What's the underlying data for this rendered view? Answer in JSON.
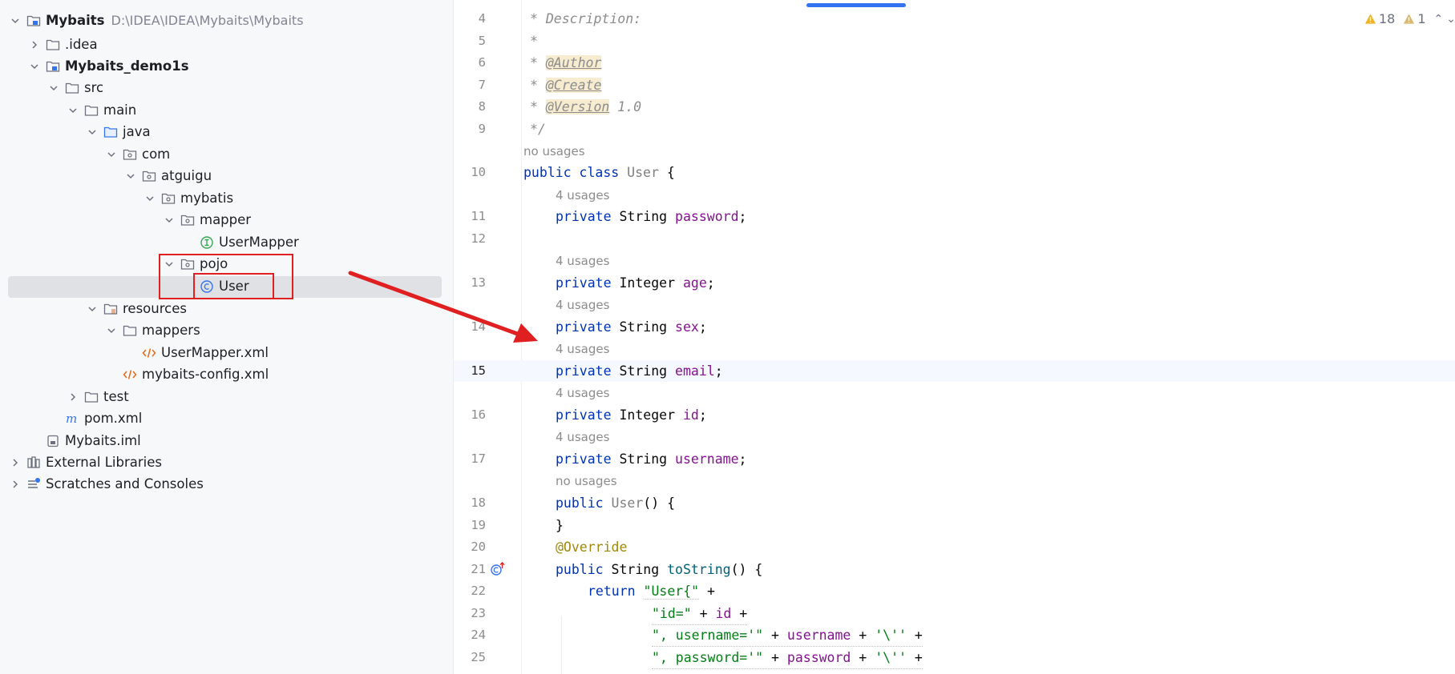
{
  "tree": {
    "root": {
      "label": "Mybaits",
      "path": "D:\\IDEA\\IDEA\\Mybaits\\Mybaits"
    },
    "items": [
      {
        "label": ".idea"
      },
      {
        "label": "Mybaits_demo1s"
      },
      {
        "label": "src"
      },
      {
        "label": "main"
      },
      {
        "label": "java"
      },
      {
        "label": "com"
      },
      {
        "label": "atguigu"
      },
      {
        "label": "mybatis"
      },
      {
        "label": "mapper"
      },
      {
        "label": "UserMapper"
      },
      {
        "label": "pojo"
      },
      {
        "label": "User"
      },
      {
        "label": "resources"
      },
      {
        "label": "mappers"
      },
      {
        "label": "UserMapper.xml"
      },
      {
        "label": "mybaits-config.xml"
      },
      {
        "label": "test"
      },
      {
        "label": "pom.xml"
      },
      {
        "label": "Mybaits.iml"
      },
      {
        "label": "External Libraries"
      },
      {
        "label": "Scratches and Consoles"
      }
    ]
  },
  "editor": {
    "inspections": {
      "warnings": "18",
      "weak_warnings": "1"
    },
    "hints": {
      "h1": "no usages",
      "h2": "4 usages",
      "h3": "4 usages",
      "h4": "4 usages",
      "h5": "4 usages",
      "h6": "4 usages",
      "h7": "4 usages",
      "h8": "no usages"
    },
    "lines": {
      "n4": "4",
      "n5": "5",
      "n6": "6",
      "n7": "7",
      "n8": "8",
      "n9": "9",
      "n10": "10",
      "n11": "11",
      "n12": "12",
      "n13": "13",
      "n14": "14",
      "n15": "15",
      "n16": "16",
      "n17": "17",
      "n18": "18",
      "n19": "19",
      "n20": "20",
      "n21": "21",
      "n22": "22",
      "n23": "23",
      "n24": "24",
      "n25": "25"
    },
    "code": {
      "l4": "* Description:",
      "l5": "*",
      "l6a": "* ",
      "l6b": "@Author",
      "l7a": "* ",
      "l7b": "@Create",
      "l8a": "* ",
      "l8b": "@Version",
      "l8c": " 1.0",
      "l9": "*/",
      "public": "public",
      "class": "class",
      "private": "private",
      "return": "return",
      "User": "User",
      "brace_open": " {",
      "brace_close": "}",
      "String": "String",
      "Integer": "Integer",
      "semi": ";",
      "password": "password",
      "age": "age",
      "sex": "sex",
      "email": "email",
      "id": "id",
      "username": "username",
      "ctor": "User",
      "ctor_tail": "() {",
      "override": "@Override",
      "toString": "toString",
      "toString_tail": "() {",
      "s22": "\"User{\"",
      "plus": " +",
      "s23": "\"id=\"",
      "s24": "\", username='\"",
      "s25": "\", password='\"",
      "quote": "'\\''"
    }
  }
}
